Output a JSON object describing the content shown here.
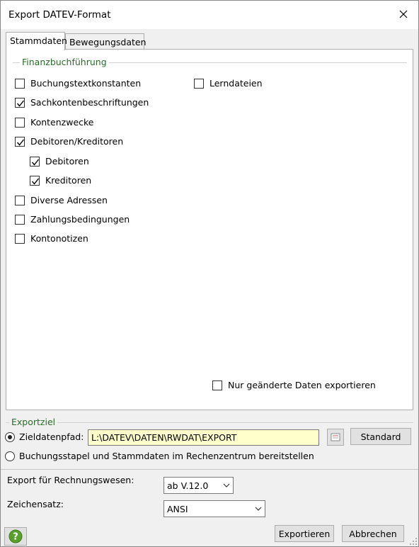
{
  "window": {
    "title": "Export DATEV-Format"
  },
  "tabs": [
    {
      "label": "Stammdaten",
      "active": true
    },
    {
      "label": "Bewegungsdaten",
      "active": false
    }
  ],
  "finanzbuchhaltung": {
    "title": "Finanzbuchführung",
    "items": [
      {
        "label": "Buchungstextkonstanten",
        "checked": false
      },
      {
        "label": "Sachkontenbeschriftungen",
        "checked": true
      },
      {
        "label": "Kontenzwecke",
        "checked": false
      },
      {
        "label": "Debitoren/Kreditoren",
        "checked": true
      },
      {
        "label": "Debitoren",
        "checked": true
      },
      {
        "label": "Kreditoren",
        "checked": true
      },
      {
        "label": "Diverse Adressen",
        "checked": false
      },
      {
        "label": "Zahlungsbedingungen",
        "checked": false
      },
      {
        "label": "Kontonotizen",
        "checked": false
      }
    ],
    "lerndateien": {
      "label": "Lerndateien",
      "checked": false
    },
    "nur_geaendert": {
      "label": "Nur geänderte Daten exportieren",
      "checked": false
    }
  },
  "exportziel": {
    "title": "Exportziel",
    "zieldatenpfad_label": "Zieldatenpfad:",
    "zieldatenpfad_value": "L:\\DATEV\\DATEN\\RWDAT\\EXPORT",
    "standard_button": "Standard",
    "rechenzentrum_label": "Buchungsstapel und Stammdaten im Rechenzentrum bereitstellen",
    "selected": "zieldatenpfad"
  },
  "export_rechnungswesen": {
    "label": "Export für Rechnungswesen:",
    "value": "ab V.12.0"
  },
  "zeichensatz": {
    "label": "Zeichensatz:",
    "value": "ANSI"
  },
  "footer": {
    "exportieren": "Exportieren",
    "abbrechen": "Abbrechen"
  },
  "colors": {
    "group_title": "#2a6b2a",
    "path_bg": "#ffffcc",
    "help_icon": "#5aa02c"
  },
  "icons": {
    "close": "close-icon",
    "browse": "folder-browse-icon",
    "help": "help-icon",
    "dropdown": "chevron-down-icon"
  }
}
